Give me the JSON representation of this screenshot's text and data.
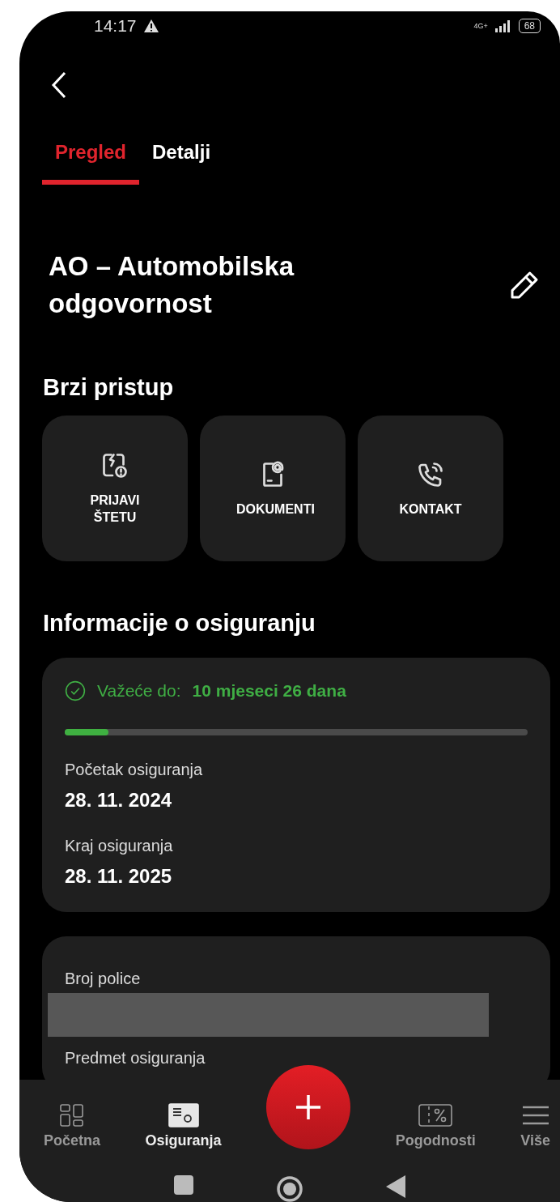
{
  "status_bar": {
    "time": "14:17",
    "network": "4G+",
    "battery": "68"
  },
  "tabs": [
    {
      "label": "Pregled",
      "selected": true
    },
    {
      "label": "Detalji",
      "selected": false
    }
  ],
  "title": "AO – Automobilska odgovornost",
  "quick_access": {
    "heading": "Brzi pristup",
    "actions": [
      {
        "kind": "claim",
        "label": "PRIJAVI ŠTETU"
      },
      {
        "kind": "documents",
        "label": "DOKUMENTI"
      },
      {
        "kind": "contact",
        "label": "KONTAKT"
      }
    ]
  },
  "info": {
    "heading": "Informacije o osiguranju",
    "validity": {
      "label": "Važeće do:",
      "value": "10 mjeseci 26 dana",
      "level": 0.095
    },
    "fields": [
      {
        "label": "Početak osiguranja",
        "value": "28. 11. 2024"
      },
      {
        "label": "Kraj osiguranja",
        "value": "28. 11. 2025"
      }
    ]
  },
  "policy": {
    "fields": [
      {
        "label": "Broj police",
        "redacted": true
      },
      {
        "label": "Predmet osiguranja",
        "redacted": false
      }
    ]
  },
  "bottom_nav": [
    {
      "kind": "home",
      "label": "Početna",
      "selected": false
    },
    {
      "kind": "insurance",
      "label": "Osiguranja",
      "selected": true
    },
    {
      "kind": "add"
    },
    {
      "kind": "benefits",
      "label": "Pogodnosti",
      "selected": false
    },
    {
      "kind": "more",
      "label": "Više",
      "selected": false
    }
  ]
}
